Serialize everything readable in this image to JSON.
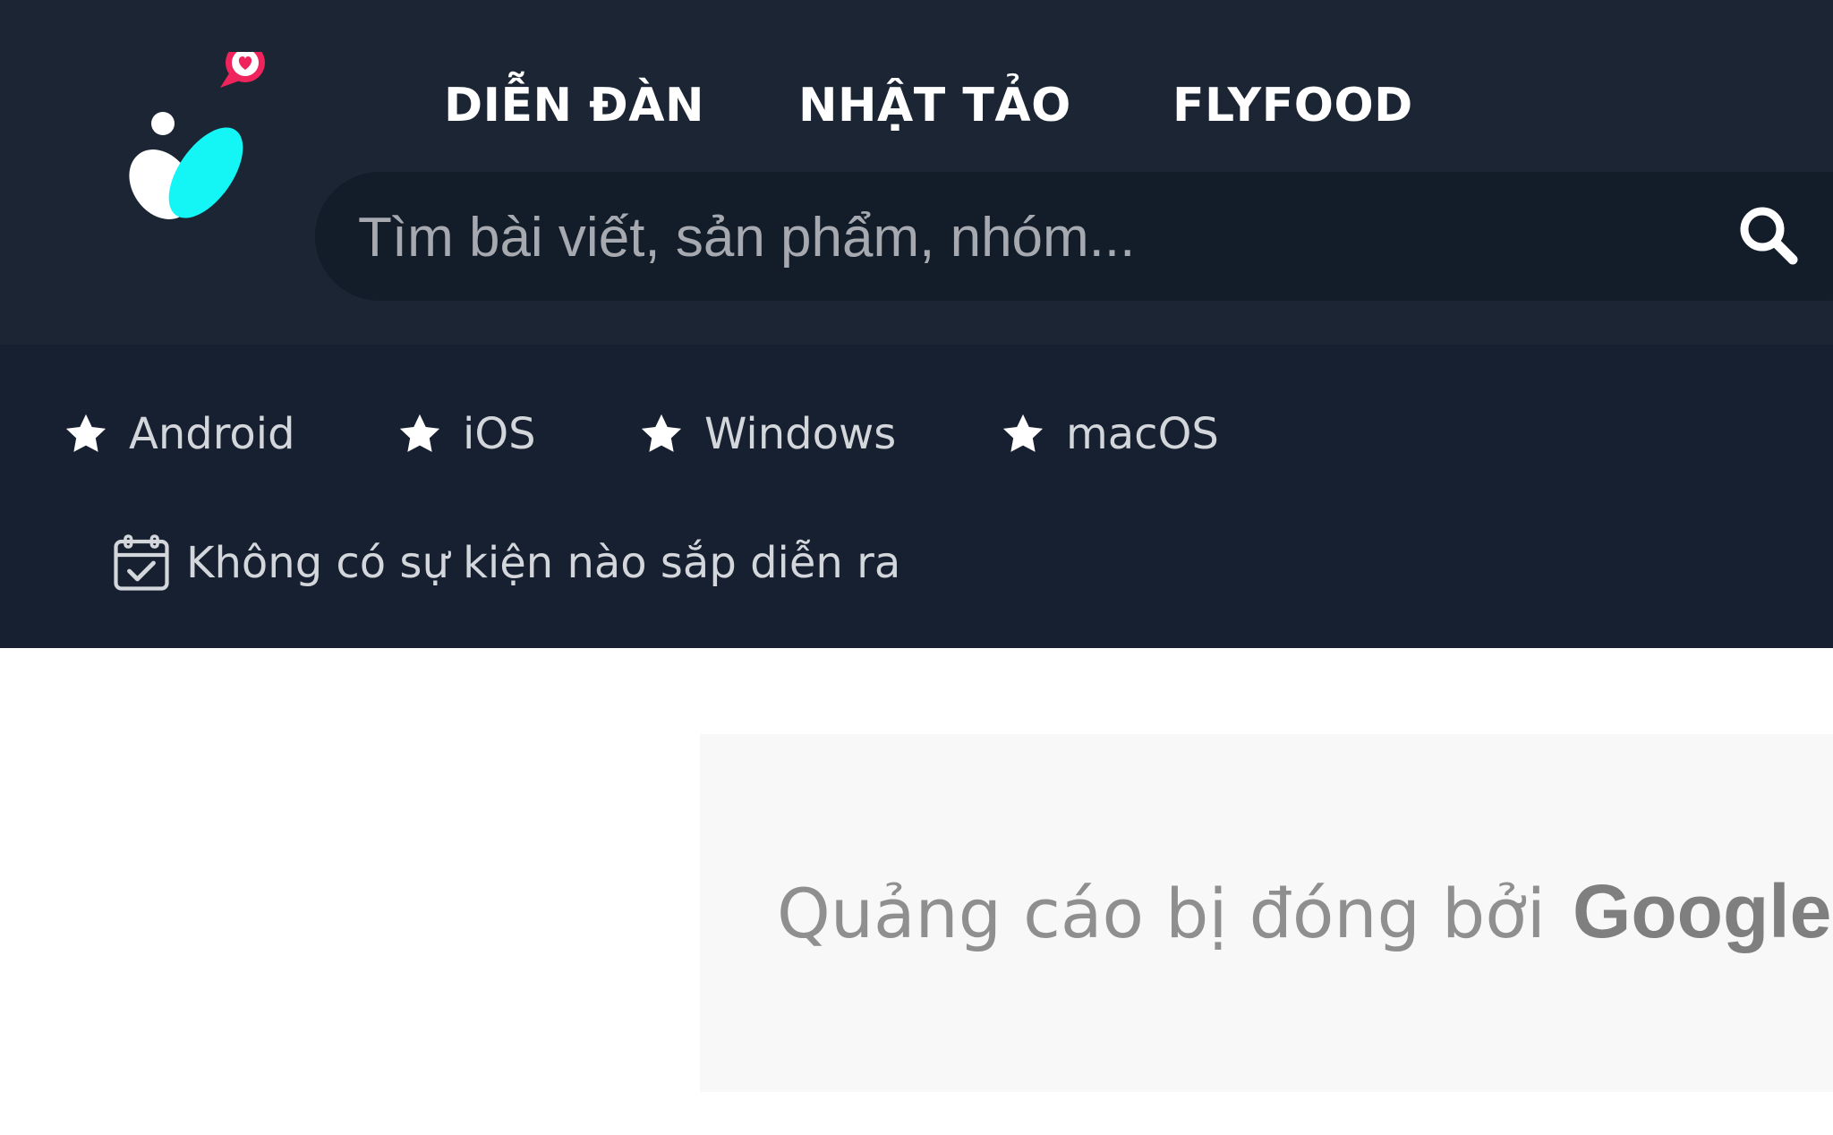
{
  "header": {
    "nav": [
      {
        "label": "DIỄN ĐÀN"
      },
      {
        "label": "NHẬT TẢO"
      },
      {
        "label": "FLYFOOD"
      }
    ],
    "search": {
      "placeholder": "Tìm bài viết, sản phẩm, nhóm...",
      "value": "",
      "icon": "search-icon"
    },
    "logo": {
      "icon": "tinhte-logo",
      "colors": {
        "cyan": "#14f5f5",
        "pink": "#f0245d",
        "white": "#ffffff"
      }
    }
  },
  "platforms": [
    {
      "label": "Android",
      "icon": "star-icon"
    },
    {
      "label": "iOS",
      "icon": "star-icon"
    },
    {
      "label": "Windows",
      "icon": "star-icon"
    },
    {
      "label": "macOS",
      "icon": "star-icon"
    }
  ],
  "event": {
    "text": "Không có sự kiện nào sắp diễn ra",
    "icon": "calendar-check-icon"
  },
  "ad": {
    "closed_text": "Quảng cáo bị đóng bởi",
    "brand": "Google"
  },
  "colors": {
    "header_top": "#1b2534",
    "header_bottom": "#172030",
    "search_bg": "#131c29",
    "ad_bg": "#f8f8f9"
  }
}
